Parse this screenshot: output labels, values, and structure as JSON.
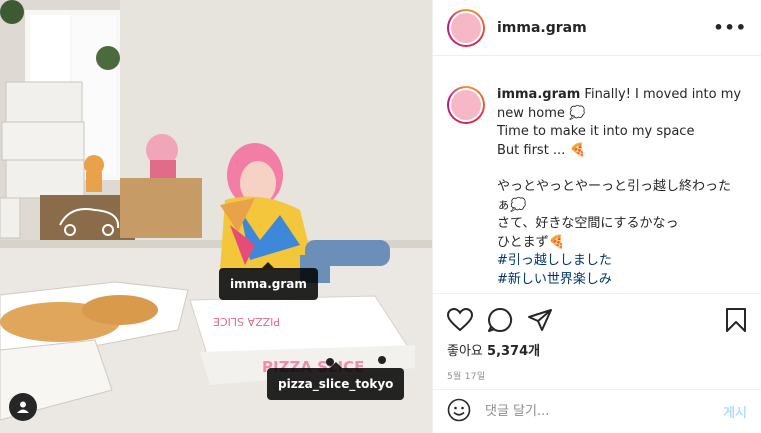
{
  "post": {
    "username": "imma.gram",
    "more_label": "•••",
    "caption": {
      "username": "imma.gram",
      "line1_suffix": " Finally! I moved into my",
      "line2": "new home 💭",
      "line3": "Time to make it into my space",
      "line4": "But first ... 🍕",
      "jp1": "やっとやっとやーっと引っ越し終わった",
      "jp2": "ぁ💭",
      "jp3": "さて、好きな空間にするかなっ",
      "jp4": "ひとまず🍕",
      "hashtags": [
        "#引っ越ししました",
        "#新しい世界楽しみ"
      ]
    },
    "likes_label": "좋아요",
    "likes_count": "5,374개",
    "date": "5월 17일",
    "comment_placeholder": "댓글 달기...",
    "post_button": "게시"
  },
  "media": {
    "tags": [
      "imma.gram",
      "pizza_slice_tokyo"
    ],
    "box_text": "PIZZA SLICE"
  },
  "icons": [
    "heart-icon",
    "comment-icon",
    "share-icon",
    "bookmark-icon",
    "emoji-icon",
    "user-tag-icon",
    "more-icon"
  ]
}
